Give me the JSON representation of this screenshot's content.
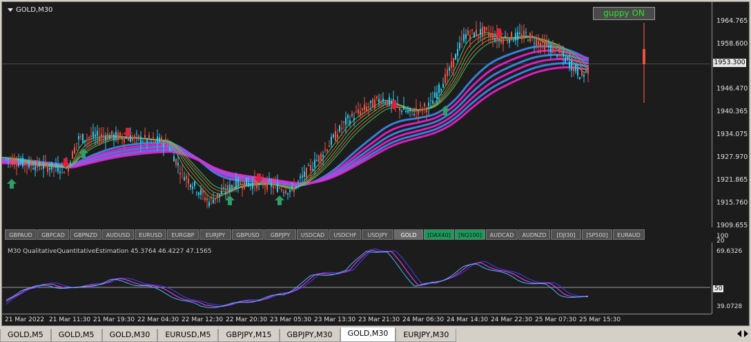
{
  "chart_title": "GOLD,M30",
  "guppy_button": "guppy ON",
  "price_axis": [
    "1964.765",
    "1958.600",
    "1946.470",
    "1940.365",
    "1934.075",
    "1927.970",
    "1921.865",
    "1915.760",
    "1909.655"
  ],
  "current_price": "1953.300",
  "symbol_bar": [
    "GBPAUD",
    "GBPCAD",
    "GBPNZD",
    "AUDUSD",
    "EURUSD",
    "EURGBP",
    "EURJPY",
    "GBPUSD",
    "GBPJPY",
    "USDCAD",
    "USDCHF",
    "USDJPY",
    "GOLD",
    "[DAX40]",
    "[NQ100]",
    "AUDCAD",
    "AUDNZD",
    "[DJI30]",
    "[SP500]",
    "EURAUD"
  ],
  "active_symbol": "GOLD",
  "green_symbols": [
    "[DAX40]",
    "[NQ100]"
  ],
  "indicator_title": "M30 QualitativeQuantitativeEstimation 45.3764 46.4227 47.1565",
  "indicator_axis": {
    "top": "100",
    "second": "20",
    "upper": "69.6326",
    "mid": "50",
    "lower": "39.0728"
  },
  "time_axis": [
    "21 Mar 2022",
    "21 Mar 11:30",
    "21 Mar 19:30",
    "22 Mar 04:30",
    "22 Mar 12:30",
    "22 Mar 20:30",
    "23 Mar 05:30",
    "23 Mar 13:30",
    "23 Mar 21:30",
    "24 Mar 06:30",
    "24 Mar 14:30",
    "24 Mar 22:30",
    "25 Mar 07:30",
    "25 Mar 15:30"
  ],
  "tabs": [
    "GOLD,M5",
    "GOLD,M5",
    "GOLD,M30",
    "EURUSD,M5",
    "GBPJPY,M15",
    "GBPJPY,M30",
    "GOLD,M30",
    "EURJPY,M30"
  ],
  "active_tab_index": 6,
  "colors": {
    "background": "#1c1c1c",
    "bull": "#2ec8f0",
    "bear": "#f05040",
    "long_guppy_up": "#3b8cf0",
    "long_guppy_down": "#f020d0",
    "up_arrow": "#2e9e6a",
    "down_arrow": "#e0203a"
  }
}
